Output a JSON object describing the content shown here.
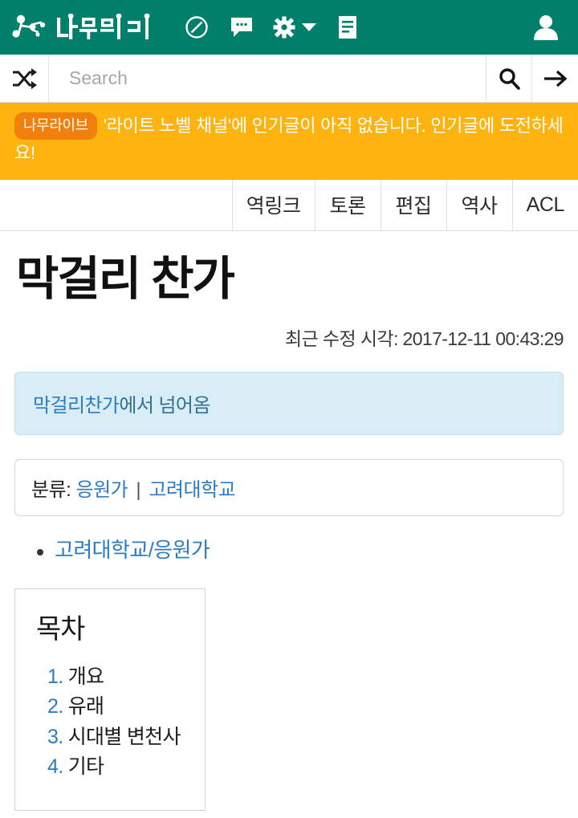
{
  "header": {
    "logo_text": "나무위키",
    "icons": [
      {
        "name": "explore-icon",
        "glyph": "compass"
      },
      {
        "name": "chat-icon",
        "glyph": "speech-bubble"
      },
      {
        "name": "settings-icon",
        "glyph": "gear"
      },
      {
        "name": "chevron-down-icon",
        "glyph": "caret-down"
      },
      {
        "name": "document-icon",
        "glyph": "note"
      }
    ],
    "profile_icon": "user-icon",
    "background_color": "#00806a"
  },
  "search": {
    "shuffle_icon": "shuffle-icon",
    "placeholder": "Search",
    "value": "",
    "search_icon": "magnifier-icon",
    "go_icon": "arrow-right-icon"
  },
  "notice": {
    "badge": "나무라이브",
    "text": "'라이트 노벨 채널'에 인기글이 아직 없습니다. 인기글에 도전하세요!",
    "background_color": "#ffb30f",
    "badge_color": "#f0800b"
  },
  "tabs": [
    {
      "label": "역링크"
    },
    {
      "label": "토론"
    },
    {
      "label": "편집"
    },
    {
      "label": "역사"
    },
    {
      "label": "ACL"
    }
  ],
  "article": {
    "title": "막걸리 찬가",
    "last_modified": "최근 수정 시각: 2017-12-11 00:43:29",
    "redirect": {
      "from": "막걸리찬가",
      "suffix": "에서 넘어옴"
    },
    "category": {
      "label": "분류:",
      "items": [
        "응원가",
        "고려대학교"
      ],
      "separator": "|"
    },
    "links": [
      {
        "label": "고려대학교/응원가"
      }
    ],
    "toc": {
      "title": "목차",
      "entries": [
        {
          "num": "1.",
          "label": "개요"
        },
        {
          "num": "2.",
          "label": "유래"
        },
        {
          "num": "3.",
          "label": "시대별 변천사"
        },
        {
          "num": "4.",
          "label": "기타"
        }
      ]
    }
  },
  "colors": {
    "brand_teal": "#00806a",
    "link_blue": "#2b7cc4",
    "notice_orange": "#ffb30f",
    "info_blue_bg": "#d9edf7"
  }
}
